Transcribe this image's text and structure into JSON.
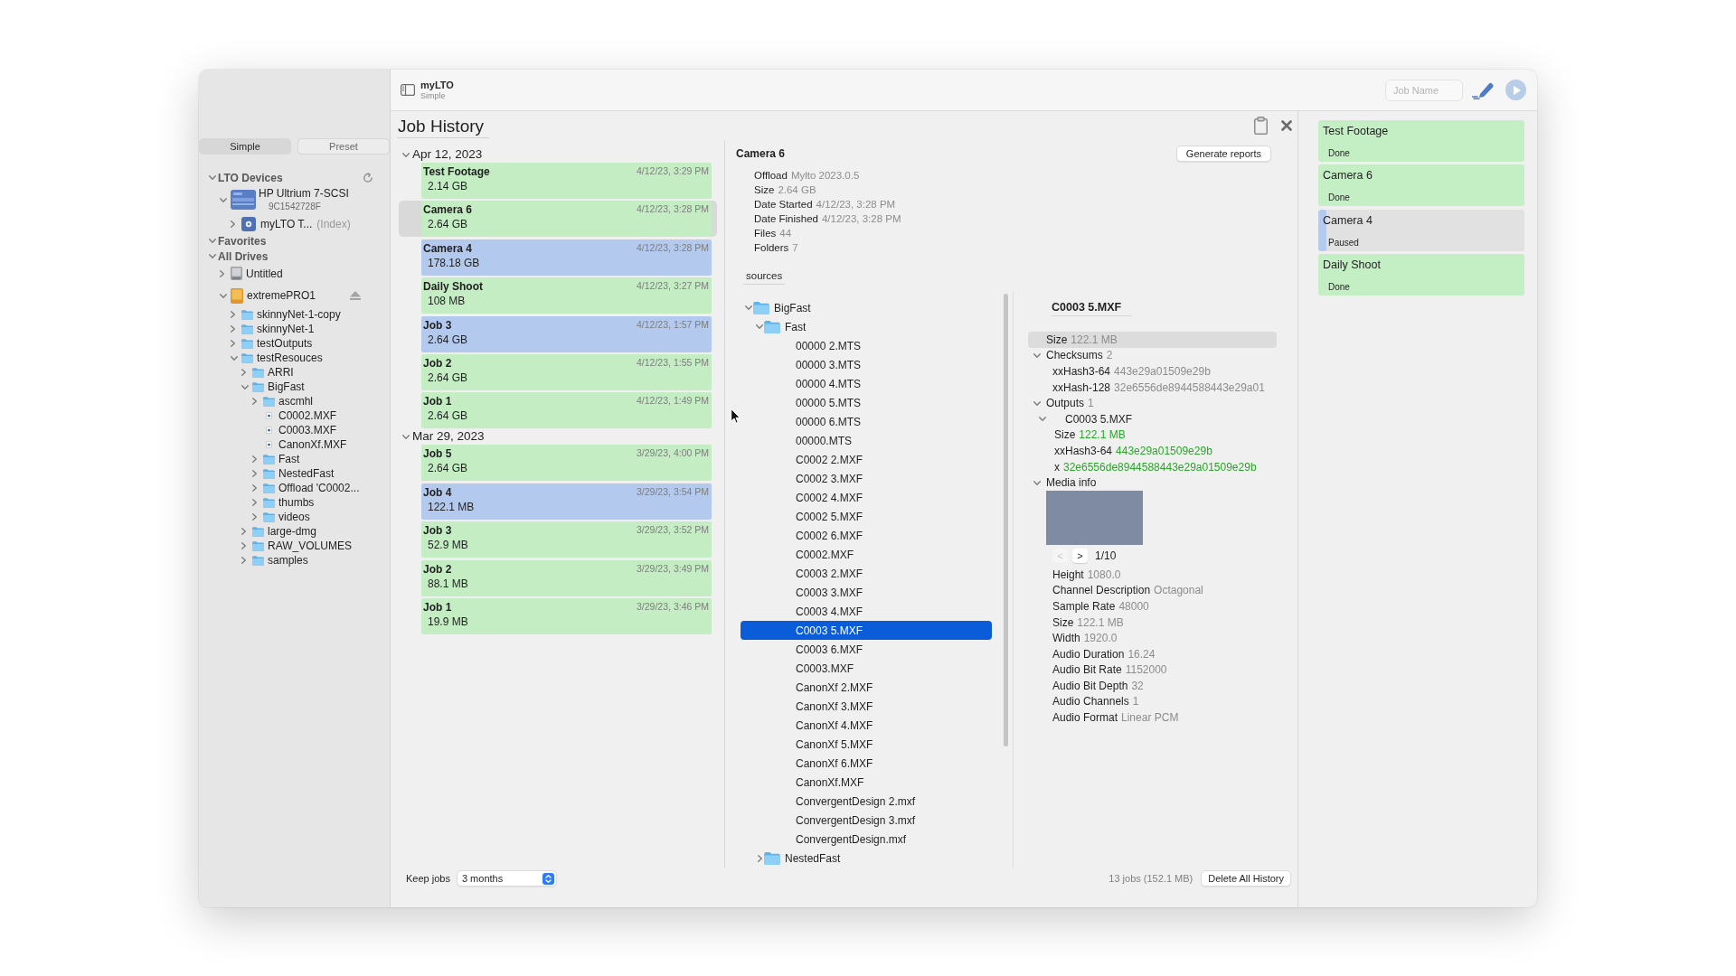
{
  "window": {
    "app_name": "myLTO",
    "mode": "Simple"
  },
  "toolbar": {
    "job_name": {
      "placeholder": "Job Name"
    },
    "run_button": {
      "disabled": true
    }
  },
  "sidebar": {
    "segments": [
      {
        "label": "Simple",
        "selected": true
      },
      {
        "label": "Preset",
        "selected": false
      }
    ],
    "sections": [
      {
        "kind": "devices",
        "title": "LTO Devices",
        "expanded": true,
        "items": [
          {
            "kind": "tape_drive",
            "name": "HP Ultrium 7-SCSI",
            "subtitle": "9C1542728F",
            "expanded": true,
            "children": [
              {
                "kind": "tape",
                "name": "myLTO T...",
                "note": "(Index)",
                "expanded": false
              }
            ]
          }
        ]
      },
      {
        "kind": "favorites",
        "title": "Favorites",
        "expanded": true
      },
      {
        "kind": "drives",
        "title": "All Drives",
        "expanded": true,
        "items": [
          {
            "kind": "disk",
            "name": "Untitled",
            "expanded": false
          },
          {
            "kind": "external_drive",
            "name": "extremePRO1",
            "expanded": true,
            "children": [
              {
                "kind": "folder",
                "name": "skinnyNet-1-copy",
                "expanded": false
              },
              {
                "kind": "folder",
                "name": "skinnyNet-1",
                "expanded": false
              },
              {
                "kind": "folder",
                "name": "testOutputs",
                "expanded": false
              },
              {
                "kind": "folder",
                "name": "testResouces",
                "expanded": true,
                "children": [
                  {
                    "kind": "folder",
                    "name": "ARRI",
                    "expanded": false
                  },
                  {
                    "kind": "folder",
                    "name": "BigFast",
                    "expanded": true,
                    "children": [
                      {
                        "kind": "folder",
                        "name": "ascmhl",
                        "expanded": false
                      },
                      {
                        "kind": "file",
                        "name": "C0002.MXF"
                      },
                      {
                        "kind": "file",
                        "name": "C0003.MXF"
                      },
                      {
                        "kind": "file",
                        "name": "CanonXf.MXF"
                      },
                      {
                        "kind": "folder",
                        "name": "Fast",
                        "expanded": false
                      },
                      {
                        "kind": "folder",
                        "name": "NestedFast",
                        "expanded": false
                      },
                      {
                        "kind": "folder",
                        "name": "Offload 'C0002...",
                        "expanded": false
                      },
                      {
                        "kind": "folder",
                        "name": "thumbs",
                        "expanded": false
                      },
                      {
                        "kind": "folder",
                        "name": "videos",
                        "expanded": false
                      }
                    ]
                  },
                  {
                    "kind": "folder",
                    "name": "large-dmg",
                    "expanded": false
                  },
                  {
                    "kind": "folder",
                    "name": "RAW_VOLUMES",
                    "expanded": false
                  },
                  {
                    "kind": "folder",
                    "name": "samples",
                    "expanded": false
                  }
                ]
              }
            ]
          }
        ]
      }
    ]
  },
  "job_history": {
    "title": "Job History",
    "groups": [
      {
        "date": "Apr 12, 2023",
        "expanded": true,
        "jobs": [
          {
            "name": "Test Footage",
            "size": "2.14 GB",
            "time": "4/12/23, 3:29 PM",
            "color": "#c4edc4",
            "selected": false
          },
          {
            "name": "Camera 6",
            "size": "2.64 GB",
            "time": "4/12/23, 3:28 PM",
            "color": "#c4edc4",
            "selected": true
          },
          {
            "name": "Camera 4",
            "size": "178.18 GB",
            "time": "4/12/23, 3:28 PM",
            "color": "#b3caee",
            "selected": false
          },
          {
            "name": "Daily Shoot",
            "size": "108 MB",
            "time": "4/12/23, 3:27 PM",
            "color": "#c4edc4",
            "selected": false
          },
          {
            "name": "Job 3",
            "size": "2.64 GB",
            "time": "4/12/23, 1:57 PM",
            "color": "#b3caee",
            "selected": false
          },
          {
            "name": "Job 2",
            "size": "2.64 GB",
            "time": "4/12/23, 1:55 PM",
            "color": "#c4edc4",
            "selected": false
          },
          {
            "name": "Job 1",
            "size": "2.64 GB",
            "time": "4/12/23, 1:49 PM",
            "color": "#c4edc4",
            "selected": false
          }
        ]
      },
      {
        "date": "Mar 29, 2023",
        "expanded": true,
        "jobs": [
          {
            "name": "Job 5",
            "size": "2.64 GB",
            "time": "3/29/23, 4:00 PM",
            "color": "#c4edc4",
            "selected": false
          },
          {
            "name": "Job 4",
            "size": "122.1 MB",
            "time": "3/29/23, 3:54 PM",
            "color": "#b3caee",
            "selected": false
          },
          {
            "name": "Job 3",
            "size": "52.9 MB",
            "time": "3/29/23, 3:52 PM",
            "color": "#c4edc4",
            "selected": false
          },
          {
            "name": "Job 2",
            "size": "88.1 MB",
            "time": "3/29/23, 3:49 PM",
            "color": "#c4edc4",
            "selected": false
          },
          {
            "name": "Job 1",
            "size": "19.9 MB",
            "time": "3/29/23, 3:46 PM",
            "color": "#c4edc4",
            "selected": false
          }
        ]
      }
    ]
  },
  "job_detail": {
    "title": "Camera 6",
    "report_button": "Generate reports",
    "properties": [
      {
        "label": "Offload",
        "value": "Mylto 2023.0.5"
      },
      {
        "label": "Size",
        "value": "2.64 GB"
      },
      {
        "label": "Date Started",
        "value": "4/12/23, 3:28 PM"
      },
      {
        "label": "Date Finished",
        "value": "4/12/23, 3:28 PM"
      },
      {
        "label": "Files",
        "value": "44"
      },
      {
        "label": "Folders",
        "value": "7"
      }
    ],
    "tab": "sources",
    "tree": [
      {
        "kind": "folder",
        "name": "BigFast",
        "expanded": true,
        "selected": false,
        "children": [
          {
            "kind": "folder",
            "name": "Fast",
            "expanded": true,
            "selected": false,
            "children": [
              {
                "kind": "file",
                "name": "00000 2.MTS",
                "selected": false
              },
              {
                "kind": "file",
                "name": "00000 3.MTS",
                "selected": false
              },
              {
                "kind": "file",
                "name": "00000 4.MTS",
                "selected": false
              },
              {
                "kind": "file",
                "name": "00000 5.MTS",
                "selected": false
              },
              {
                "kind": "file",
                "name": "00000 6.MTS",
                "selected": false
              },
              {
                "kind": "file",
                "name": "00000.MTS",
                "selected": false
              },
              {
                "kind": "file",
                "name": "C0002 2.MXF",
                "selected": false
              },
              {
                "kind": "file",
                "name": "C0002 3.MXF",
                "selected": false
              },
              {
                "kind": "file",
                "name": "C0002 4.MXF",
                "selected": false
              },
              {
                "kind": "file",
                "name": "C0002 5.MXF",
                "selected": false
              },
              {
                "kind": "file",
                "name": "C0002 6.MXF",
                "selected": false
              },
              {
                "kind": "file",
                "name": "C0002.MXF",
                "selected": false
              },
              {
                "kind": "file",
                "name": "C0003 2.MXF",
                "selected": false
              },
              {
                "kind": "file",
                "name": "C0003 3.MXF",
                "selected": false
              },
              {
                "kind": "file",
                "name": "C0003 4.MXF",
                "selected": false
              },
              {
                "kind": "file",
                "name": "C0003 5.MXF",
                "selected": true
              },
              {
                "kind": "file",
                "name": "C0003 6.MXF",
                "selected": false
              },
              {
                "kind": "file",
                "name": "C0003.MXF",
                "selected": false
              },
              {
                "kind": "file",
                "name": "CanonXf 2.MXF",
                "selected": false
              },
              {
                "kind": "file",
                "name": "CanonXf 3.MXF",
                "selected": false
              },
              {
                "kind": "file",
                "name": "CanonXf 4.MXF",
                "selected": false
              },
              {
                "kind": "file",
                "name": "CanonXf 5.MXF",
                "selected": false
              },
              {
                "kind": "file",
                "name": "CanonXf 6.MXF",
                "selected": false
              },
              {
                "kind": "file",
                "name": "CanonXf.MXF",
                "selected": false
              },
              {
                "kind": "file",
                "name": "ConvergentDesign 2.mxf",
                "selected": false
              },
              {
                "kind": "file",
                "name": "ConvergentDesign 3.mxf",
                "selected": false
              },
              {
                "kind": "file",
                "name": "ConvergentDesign.mxf",
                "selected": false
              }
            ]
          },
          {
            "kind": "folder",
            "name": "NestedFast",
            "expanded": false,
            "selected": false
          }
        ]
      }
    ]
  },
  "file_detail": {
    "title": "C0003 5.MXF",
    "rows": [
      {
        "kind": "property",
        "label": "Size",
        "value": "122.1 MB",
        "selected": true
      },
      {
        "kind": "group",
        "label": "Checksums",
        "count": "2",
        "expanded": true,
        "selected": false,
        "children": [
          {
            "kind": "property",
            "label": "xxHash3-64",
            "value": "443e29a01509e29b",
            "verified": false
          },
          {
            "kind": "property",
            "label": "xxHash-128",
            "value": "32e6556de8944588443e29a01",
            "verified": false
          }
        ]
      },
      {
        "kind": "group",
        "label": "Outputs",
        "count": "1",
        "expanded": true,
        "selected": false,
        "children": [
          {
            "kind": "output",
            "name": "C0003 5.MXF",
            "expanded": true,
            "children": [
              {
                "label": "Size",
                "value": "122.1 MB",
                "verified": true
              },
              {
                "label": "xxHash3-64",
                "value": "443e29a01509e29b",
                "verified": true
              },
              {
                "label": "x",
                "value": "32e6556de8944588443e29a01509e29b",
                "verified": true
              }
            ]
          }
        ]
      },
      {
        "kind": "media",
        "label": "Media info",
        "expanded": true,
        "selected": false,
        "pager": {
          "prev": {
            "label": "<",
            "disabled": true
          },
          "next": {
            "label": ">",
            "disabled": false
          },
          "position": "1/10"
        },
        "properties": [
          {
            "label": "Height",
            "value": "1080.0"
          },
          {
            "label": "Channel Description",
            "value": "Octagonal"
          },
          {
            "label": "Sample Rate",
            "value": "48000"
          },
          {
            "label": "Size",
            "value": "122.1 MB"
          },
          {
            "label": "Width",
            "value": "1920.0"
          },
          {
            "label": "Audio Duration",
            "value": "16.24"
          },
          {
            "label": "Audio Bit Rate",
            "value": "1152000"
          },
          {
            "label": "Audio Bit Depth",
            "value": "32"
          },
          {
            "label": "Audio Channels",
            "value": "1"
          },
          {
            "label": "Audio Format",
            "value": "Linear PCM"
          }
        ]
      }
    ]
  },
  "footer": {
    "keep_jobs": {
      "label": "Keep jobs",
      "value": "3 months"
    },
    "summary": "13 jobs (152.1 MB)",
    "delete_button": "Delete All History"
  },
  "queue": [
    {
      "name": "Test Footage",
      "status": "Done",
      "level": 1,
      "color": "#c4eec4"
    },
    {
      "name": "Camera 6",
      "status": "Done",
      "level": 1,
      "color": "#c4eec4"
    },
    {
      "name": "Camera 4",
      "status": "Paused",
      "level": 0.04,
      "color": "#b4cbee"
    },
    {
      "name": "Daily Shoot",
      "status": "Done",
      "level": 1,
      "color": "#c4eec4"
    }
  ]
}
